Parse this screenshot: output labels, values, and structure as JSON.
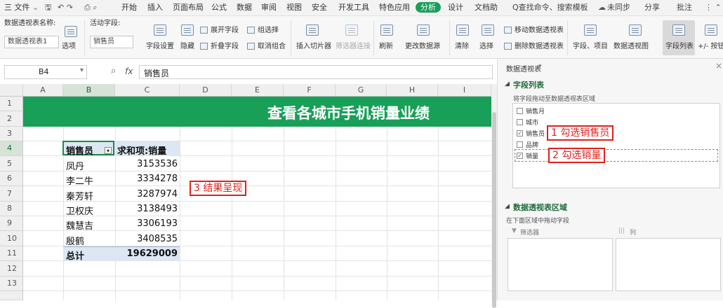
{
  "colors": {
    "accent": "#18a058",
    "annotation": "#e0201b",
    "header_fill": "#dde7f3"
  },
  "menu": {
    "file": "三 文件",
    "items": [
      "开始",
      "插入",
      "页面布局",
      "公式",
      "数据",
      "审阅",
      "视图",
      "安全",
      "开发工具",
      "特色应用"
    ],
    "active_tab": "分析",
    "after_tabs": [
      "设计",
      "文档助"
    ],
    "search": "Q查找命令、搜索模板",
    "sync": "未同步",
    "share": "分享",
    "comment": "批注"
  },
  "ribbon": {
    "name_label": "数据透视表名称:",
    "name_value": "数据透视表1",
    "options": "选项",
    "active_field_label": "活动字段:",
    "active_field_value": "销售员",
    "field_settings": "字段设置",
    "hide": "隐藏",
    "expand_field": "展开字段",
    "collapse_field": "折叠字段",
    "group_select": "组选择",
    "ungroup": "取消组合",
    "insert_slicer": "插入切片器",
    "filter_connection": "筛选器连接",
    "refresh": "刷新",
    "change_source": "更改数据源",
    "clear": "清除",
    "select": "选择",
    "move_pivot": "移动数据透视表",
    "delete_pivot": "删除数据透视表",
    "fields_items": "字段、项目",
    "pivot_chart": "数据透视图",
    "field_list": "字段列表",
    "plus_minus": "+/- 按钮"
  },
  "formula_bar": {
    "cell_ref": "B4",
    "fx": "fx",
    "value": "销售员"
  },
  "sheet": {
    "columns": [
      "A",
      "B",
      "C",
      "D",
      "E",
      "F",
      "G",
      "H",
      "I"
    ],
    "rows": [
      "1",
      "2",
      "3",
      "4",
      "5",
      "6",
      "7",
      "8",
      "9",
      "10",
      "11",
      "12",
      "13"
    ],
    "banner_title": "查看各城市手机销量业绩",
    "pivot_header": {
      "col1": "销售员",
      "col2": "求和项:销量"
    },
    "pivot_rows": [
      {
        "name": "凤丹",
        "value": "3153536"
      },
      {
        "name": "李二牛",
        "value": "3334278"
      },
      {
        "name": "秦芳轩",
        "value": "3287974"
      },
      {
        "name": "卫权庆",
        "value": "3138493"
      },
      {
        "name": "魏慧吉",
        "value": "3306193"
      },
      {
        "name": "殷鹤",
        "value": "3408535"
      }
    ],
    "total": {
      "name": "总计",
      "value": "19629009"
    },
    "annotation_result": "3 结果呈现"
  },
  "panel": {
    "title": "数据透视表",
    "field_list_section": "字段列表",
    "field_hint": "将字段拖动至数据透视表区域",
    "fields": [
      {
        "label": "销售月",
        "checked": false
      },
      {
        "label": "城市",
        "checked": false
      },
      {
        "label": "销售员",
        "checked": true
      },
      {
        "label": "品牌",
        "checked": false
      },
      {
        "label": "销量",
        "checked": true
      }
    ],
    "annotation_step1": "1 勾选销售员",
    "annotation_step2": "2 勾选销量",
    "area_section": "数据透视表区域",
    "area_hint": "在下面区域中拖动字段",
    "filter_label": "筛选器",
    "column_label": "列"
  }
}
